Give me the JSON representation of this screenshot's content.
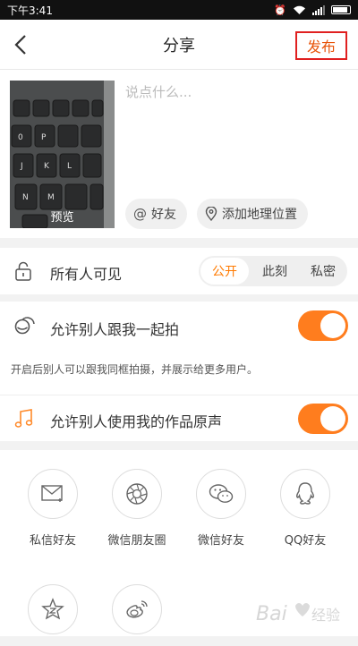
{
  "status_bar": {
    "time": "下午3:41"
  },
  "nav": {
    "title": "分享",
    "publish_label": "发布"
  },
  "compose": {
    "preview_label": "预览",
    "placeholder": "说点什么...",
    "chips": [
      {
        "label": "好友",
        "icon": "at-icon"
      },
      {
        "label": "添加地理位置",
        "icon": "location-pin-icon"
      }
    ]
  },
  "privacy": {
    "label": "所有人可见",
    "icon": "lock-icon",
    "options": [
      "公开",
      "此刻",
      "私密"
    ],
    "selected": "公开"
  },
  "coshoot": {
    "label": "允许别人跟我一起拍",
    "icon": "co-shoot-icon",
    "enabled": true,
    "hint": "开启后别人可以跟我同框拍摄，并展示给更多用户。"
  },
  "sound": {
    "label": "允许别人使用我的作品原声",
    "icon": "music-note-icon",
    "enabled": true
  },
  "share_targets": [
    {
      "label": "私信好友",
      "icon": "mail-icon"
    },
    {
      "label": "微信朋友圈",
      "icon": "moments-icon"
    },
    {
      "label": "微信好友",
      "icon": "wechat-icon"
    },
    {
      "label": "QQ好友",
      "icon": "qq-icon"
    },
    {
      "label": "",
      "icon": "qzone-icon"
    },
    {
      "label": "",
      "icon": "weibo-icon"
    }
  ],
  "colors": {
    "accent": "#ff7d1e",
    "highlight_border": "#e02020"
  }
}
